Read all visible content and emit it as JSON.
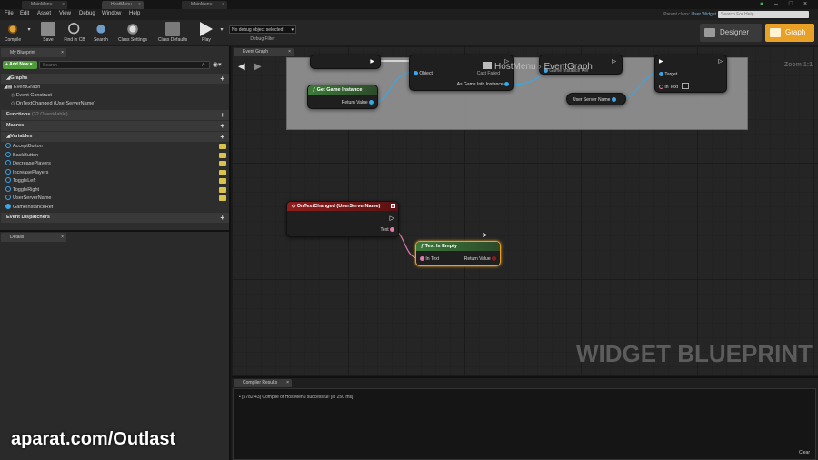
{
  "titlebar": {
    "tabs": [
      "MainMenu",
      "HostMenu",
      "MainMenu"
    ]
  },
  "menu": [
    "File",
    "Edit",
    "Asset",
    "View",
    "Debug",
    "Window",
    "Help"
  ],
  "parent_class_label": "Parent class:",
  "parent_class_value": "User Widget",
  "help_search_placeholder": "Search For Help",
  "toolbar": {
    "buttons": [
      "Compile",
      "Save",
      "Find in CB",
      "Search",
      "Class Settings",
      "Class Defaults",
      "Play"
    ],
    "debug_select": "No debug object selected",
    "debug_filter": "Debug Filter",
    "designer": "Designer",
    "graph": "Graph"
  },
  "left_panel": {
    "tab": "My Blueprint",
    "add_new": "Add New",
    "search_placeholder": "Search",
    "graphs_header": "Graphs",
    "event_graph": "EventGraph",
    "events": [
      "Event Construct",
      "OnTextChanged (UserServerName)"
    ],
    "functions_header": "Functions",
    "functions_note": "(32 Overridable)",
    "macros_header": "Macros",
    "variables_header": "Variables",
    "variables": [
      "AcceptButton",
      "BackButton",
      "DecreasePlayers",
      "IncreasePlayers",
      "ToggleLeft",
      "ToggleRight",
      "UserServerName",
      "GameInstanceRef"
    ],
    "dispatchers_header": "Event Dispatchers",
    "details_tab": "Details"
  },
  "graph": {
    "tab": "Event Graph",
    "breadcrumb_a": "HostMenu",
    "breadcrumb_b": "EventGraph",
    "zoom": "Zoom 1:1",
    "watermark": "WIDGET BLUEPRINT",
    "nodes": {
      "get_game_instance": {
        "title": "Get Game Instance",
        "out": "Return Value"
      },
      "cast": {
        "object": "Object",
        "cast_failed": "Cast Failed",
        "as": "As Game Info Instance"
      },
      "set_ref": {
        "pin": "Game Instance Ref"
      },
      "target_node": {
        "target": "Target",
        "in_text": "In Text"
      },
      "user_server_name": {
        "title": "User Server Name"
      },
      "on_text_changed": {
        "title": "OnTextChanged (UserServerName)",
        "text": "Text"
      },
      "text_is_empty": {
        "title": "Text Is Empty",
        "in": "In Text",
        "out": "Return Value"
      }
    }
  },
  "compile": {
    "tab": "Compiler Results",
    "message": "[5782.43] Compile of HostMenu successful! [in 250 ms]",
    "clear": "Clear"
  },
  "overlay_watermark": "aparat.com/Outlast"
}
